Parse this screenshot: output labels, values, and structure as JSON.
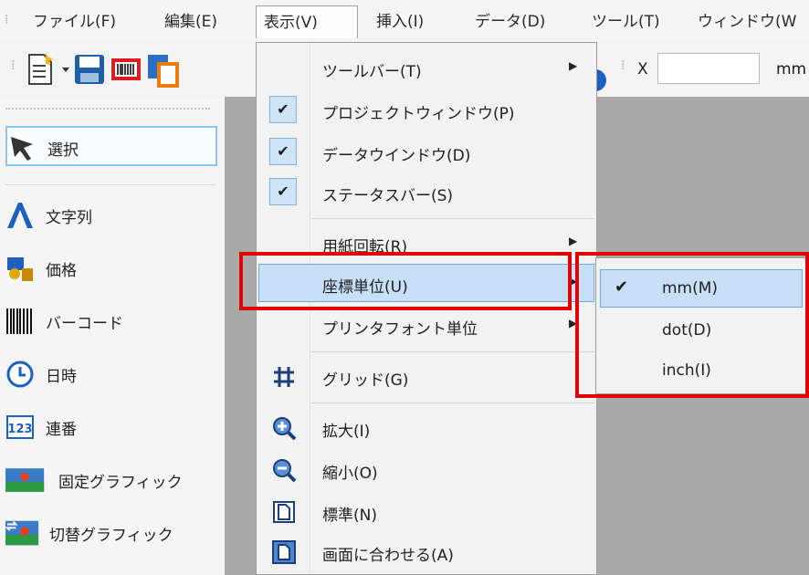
{
  "menubar": {
    "items": [
      "ファイル(F)",
      "編集(E)",
      "表示(V)",
      "挿入(I)",
      "データ(D)",
      "ツール(T)",
      "ウィンドウ(W"
    ]
  },
  "toolbar": {
    "x_label": "X",
    "x_value": "",
    "unit": "mm"
  },
  "palette": {
    "items": [
      "選択",
      "文字列",
      "価格",
      "バーコード",
      "日時",
      "連番",
      "固定グラフィック",
      "切替グラフィック"
    ],
    "selected": "選択"
  },
  "view_menu": {
    "items": [
      {
        "label": "ツールバー(T)",
        "submenu": true
      },
      {
        "label": "プロジェクトウィンドウ(P)",
        "checked": true
      },
      {
        "label": "データウインドウ(D)",
        "checked": true
      },
      {
        "label": "ステータスバー(S)",
        "checked": true
      },
      {
        "label": "用紙回転(R)",
        "submenu": true
      },
      {
        "label": "座標単位(U)",
        "submenu": true,
        "highlighted": true
      },
      {
        "label": "プリンタフォント単位",
        "submenu": true
      },
      {
        "label": "グリッド(G)",
        "icon": "grid-icon"
      },
      {
        "label": "拡大(I)",
        "icon": "zoom-in-icon"
      },
      {
        "label": "縮小(O)",
        "icon": "zoom-out-icon"
      },
      {
        "label": "標準(N)",
        "icon": "page-icon"
      },
      {
        "label": "画面に合わせる(A)",
        "icon": "fit-page-icon"
      }
    ]
  },
  "coord_submenu": {
    "items": [
      {
        "label": "mm(M)",
        "checked": true
      },
      {
        "label": "dot(D)"
      },
      {
        "label": "inch(I)"
      }
    ]
  },
  "colors": {
    "highlight": "#c7e0f7",
    "annotation": "#e00000"
  }
}
